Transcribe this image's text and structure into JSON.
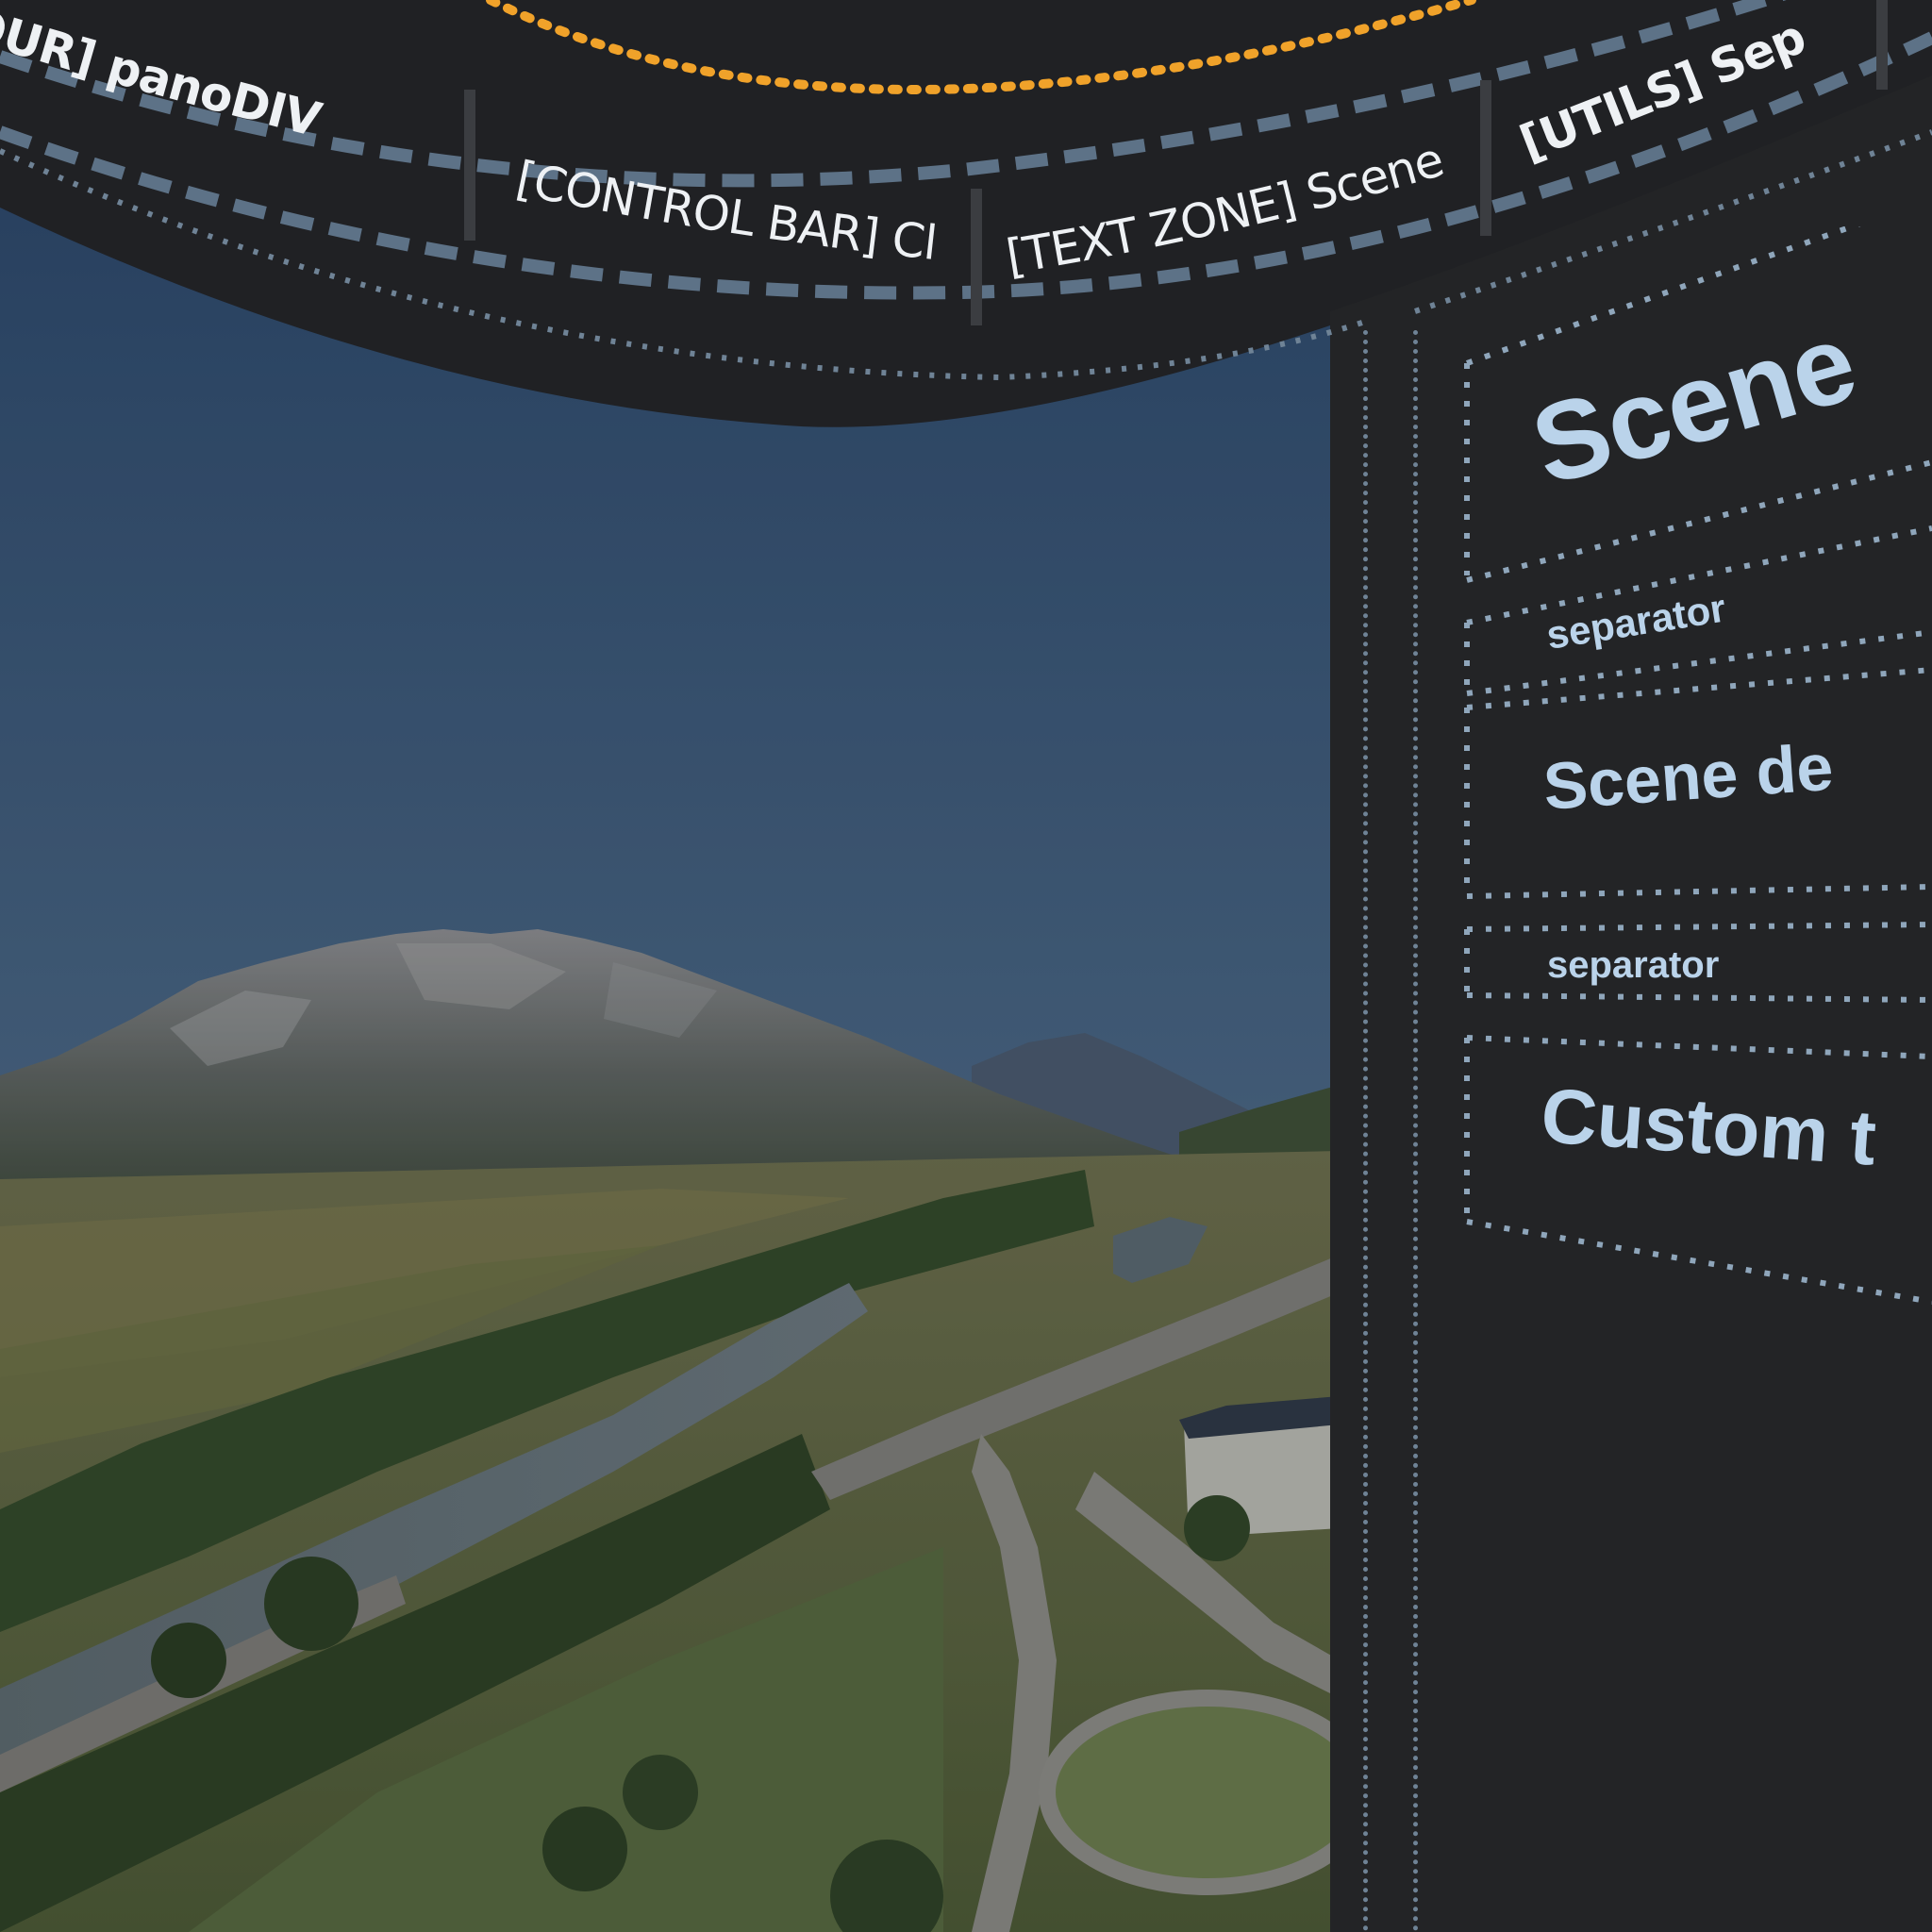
{
  "top_bar": {
    "tabs": [
      {
        "label": "OUR] panoDIV"
      },
      {
        "label": "[CONTROL BAR] Classic"
      },
      {
        "label": "[TEXT ZONE] Scene title"
      },
      {
        "label": "[UTILS] Sep"
      }
    ],
    "accent_color": "#f0a22a",
    "dash_color": "#5d7287"
  },
  "panorama": {
    "description_alt": ""
  },
  "text_zone": {
    "items": [
      {
        "label": "Scene"
      },
      {
        "label": "separator"
      },
      {
        "label": "Scene de"
      },
      {
        "label": "separator"
      },
      {
        "label": "Custom t"
      }
    ],
    "text_color": "#bad3ea",
    "border_color": "#8fa6bb"
  }
}
